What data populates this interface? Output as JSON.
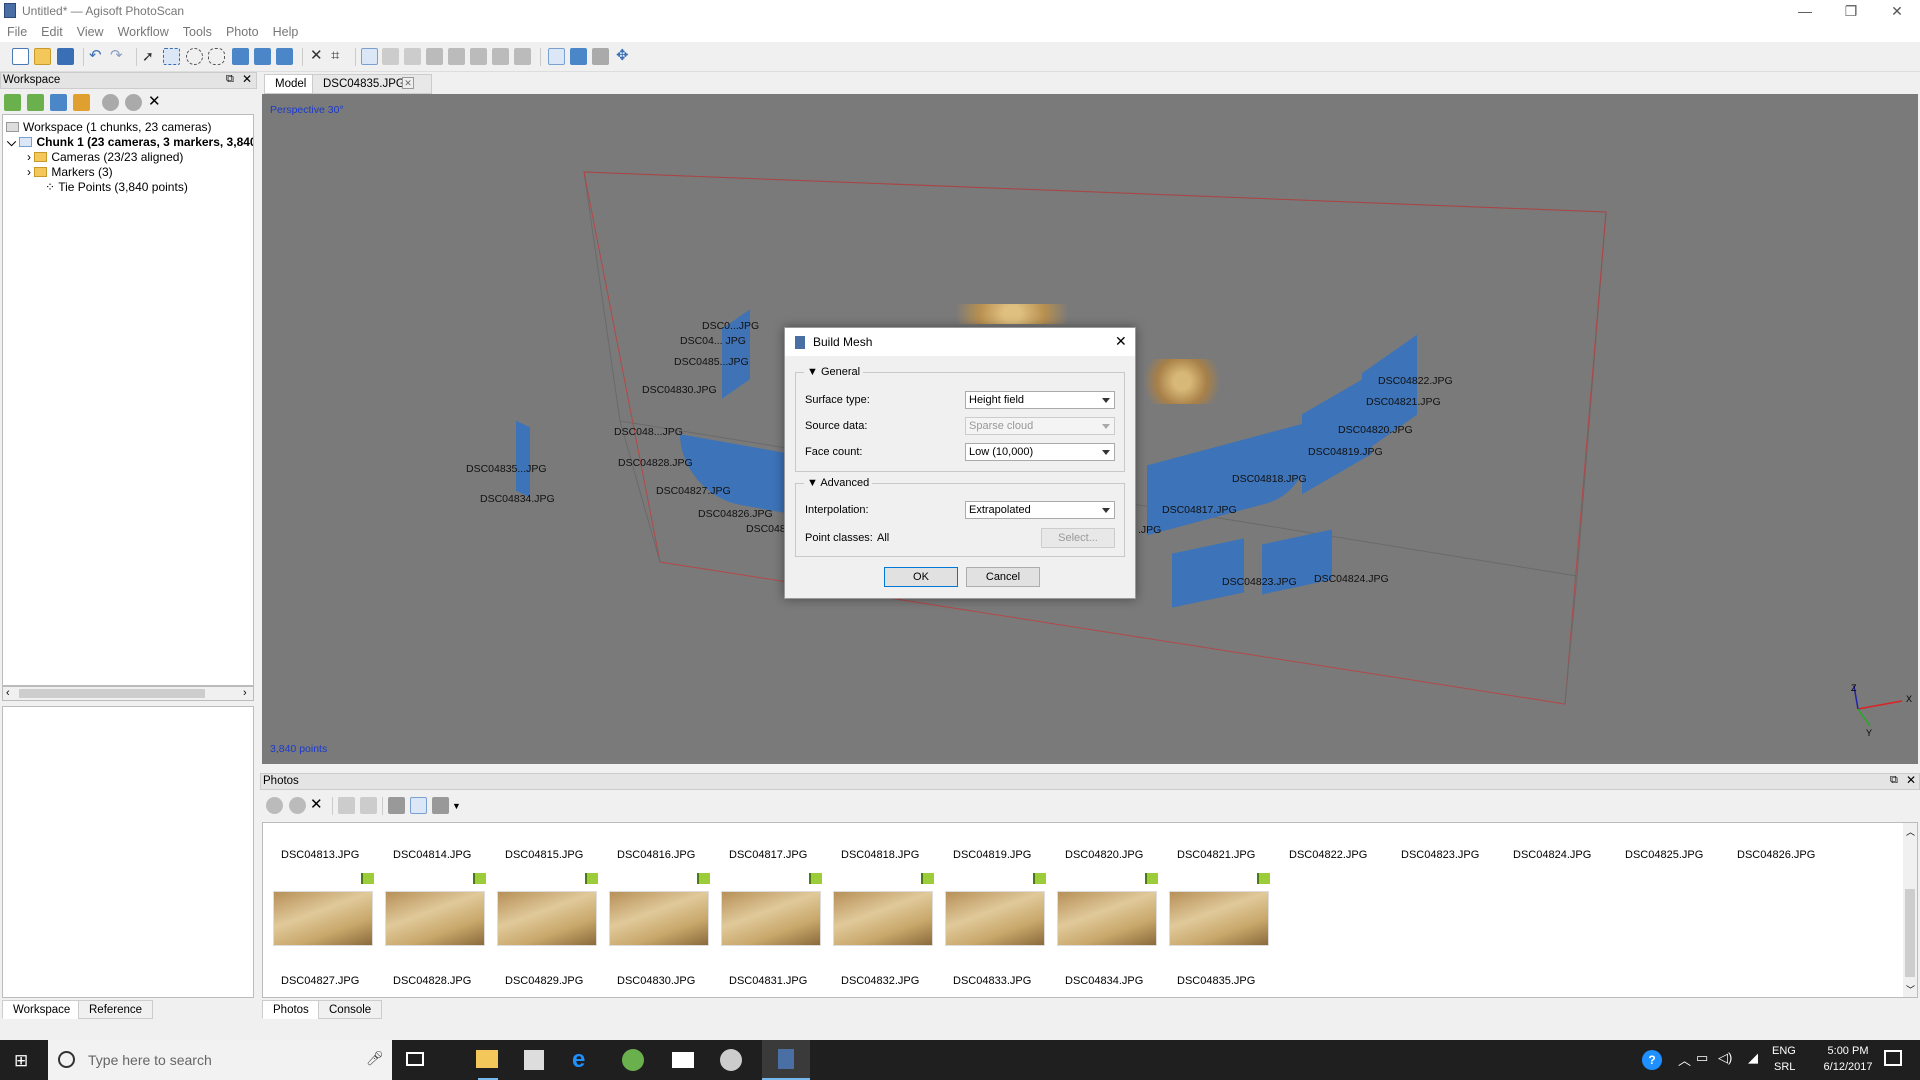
{
  "window": {
    "title": "Untitled* — Agisoft PhotoScan"
  },
  "menu": [
    "File",
    "Edit",
    "View",
    "Workflow",
    "Tools",
    "Photo",
    "Help"
  ],
  "workspace": {
    "title": "Workspace",
    "root": "Workspace (1 chunks, 23 cameras)",
    "chunk": "Chunk 1 (23 cameras, 3 markers, 3,840",
    "cameras": "Cameras (23/23 aligned)",
    "markers": "Markers (3)",
    "tiepoints": "Tie Points (3,840 points)",
    "tabs": [
      "Workspace",
      "Reference"
    ]
  },
  "view": {
    "tabs": [
      "Model",
      "DSC04835.JPG"
    ],
    "perspective": "Perspective 30°",
    "points": "3,840 points",
    "axis": {
      "z": "Z",
      "x": "X",
      "y": "Y"
    },
    "cameras": [
      {
        "label": "DSC0...JPG"
      },
      {
        "label": "DSC04... JPG"
      },
      {
        "label": "DSC0485...JPG"
      },
      {
        "label": "DSC04830.JPG"
      },
      {
        "label": "DSC048...JPG"
      },
      {
        "label": "DSC04828.JPG"
      },
      {
        "label": "DSC04835...JPG"
      },
      {
        "label": "DSC04834.JPG"
      },
      {
        "label": "DSC04827.JPG"
      },
      {
        "label": "DSC04826.JPG"
      },
      {
        "label": "DSC048"
      },
      {
        "label": "DSC04822.JPG"
      },
      {
        "label": "DSC04821.JPG"
      },
      {
        "label": "DSC04820.JPG"
      },
      {
        "label": "DSC04819.JPG"
      },
      {
        "label": "DSC04818.JPG"
      },
      {
        "label": "DSC04817.JPG"
      },
      {
        "label": ".JPG"
      },
      {
        "label": "DSC04823.JPG"
      },
      {
        "label": "DSC04824.JPG"
      }
    ]
  },
  "dialog": {
    "title": "Build Mesh",
    "general": "General",
    "surface_label": "Surface type:",
    "surface_value": "Height field",
    "source_label": "Source data:",
    "source_value": "Sparse cloud",
    "face_label": "Face count:",
    "face_value": "Low (10,000)",
    "advanced": "Advanced",
    "interp_label": "Interpolation:",
    "interp_value": "Extrapolated",
    "classes_label": "Point classes:",
    "classes_value": "All",
    "select_btn": "Select...",
    "ok": "OK",
    "cancel": "Cancel"
  },
  "photos": {
    "title": "Photos",
    "row1": [
      "DSC04813.JPG",
      "DSC04814.JPG",
      "DSC04815.JPG",
      "DSC04816.JPG",
      "DSC04817.JPG",
      "DSC04818.JPG",
      "DSC04819.JPG",
      "DSC04820.JPG",
      "DSC04821.JPG",
      "DSC04822.JPG",
      "DSC04823.JPG",
      "DSC04824.JPG",
      "DSC04825.JPG",
      "DSC04826.JPG"
    ],
    "row2": [
      "DSC04827.JPG",
      "DSC04828.JPG",
      "DSC04829.JPG",
      "DSC04830.JPG",
      "DSC04831.JPG",
      "DSC04832.JPG",
      "DSC04833.JPG",
      "DSC04834.JPG",
      "DSC04835.JPG"
    ],
    "tabs": [
      "Photos",
      "Console"
    ]
  },
  "taskbar": {
    "search": "Type here to search",
    "lang": "ENG",
    "locale": "SRL",
    "time": "5:00 PM",
    "date": "6/12/2017"
  }
}
